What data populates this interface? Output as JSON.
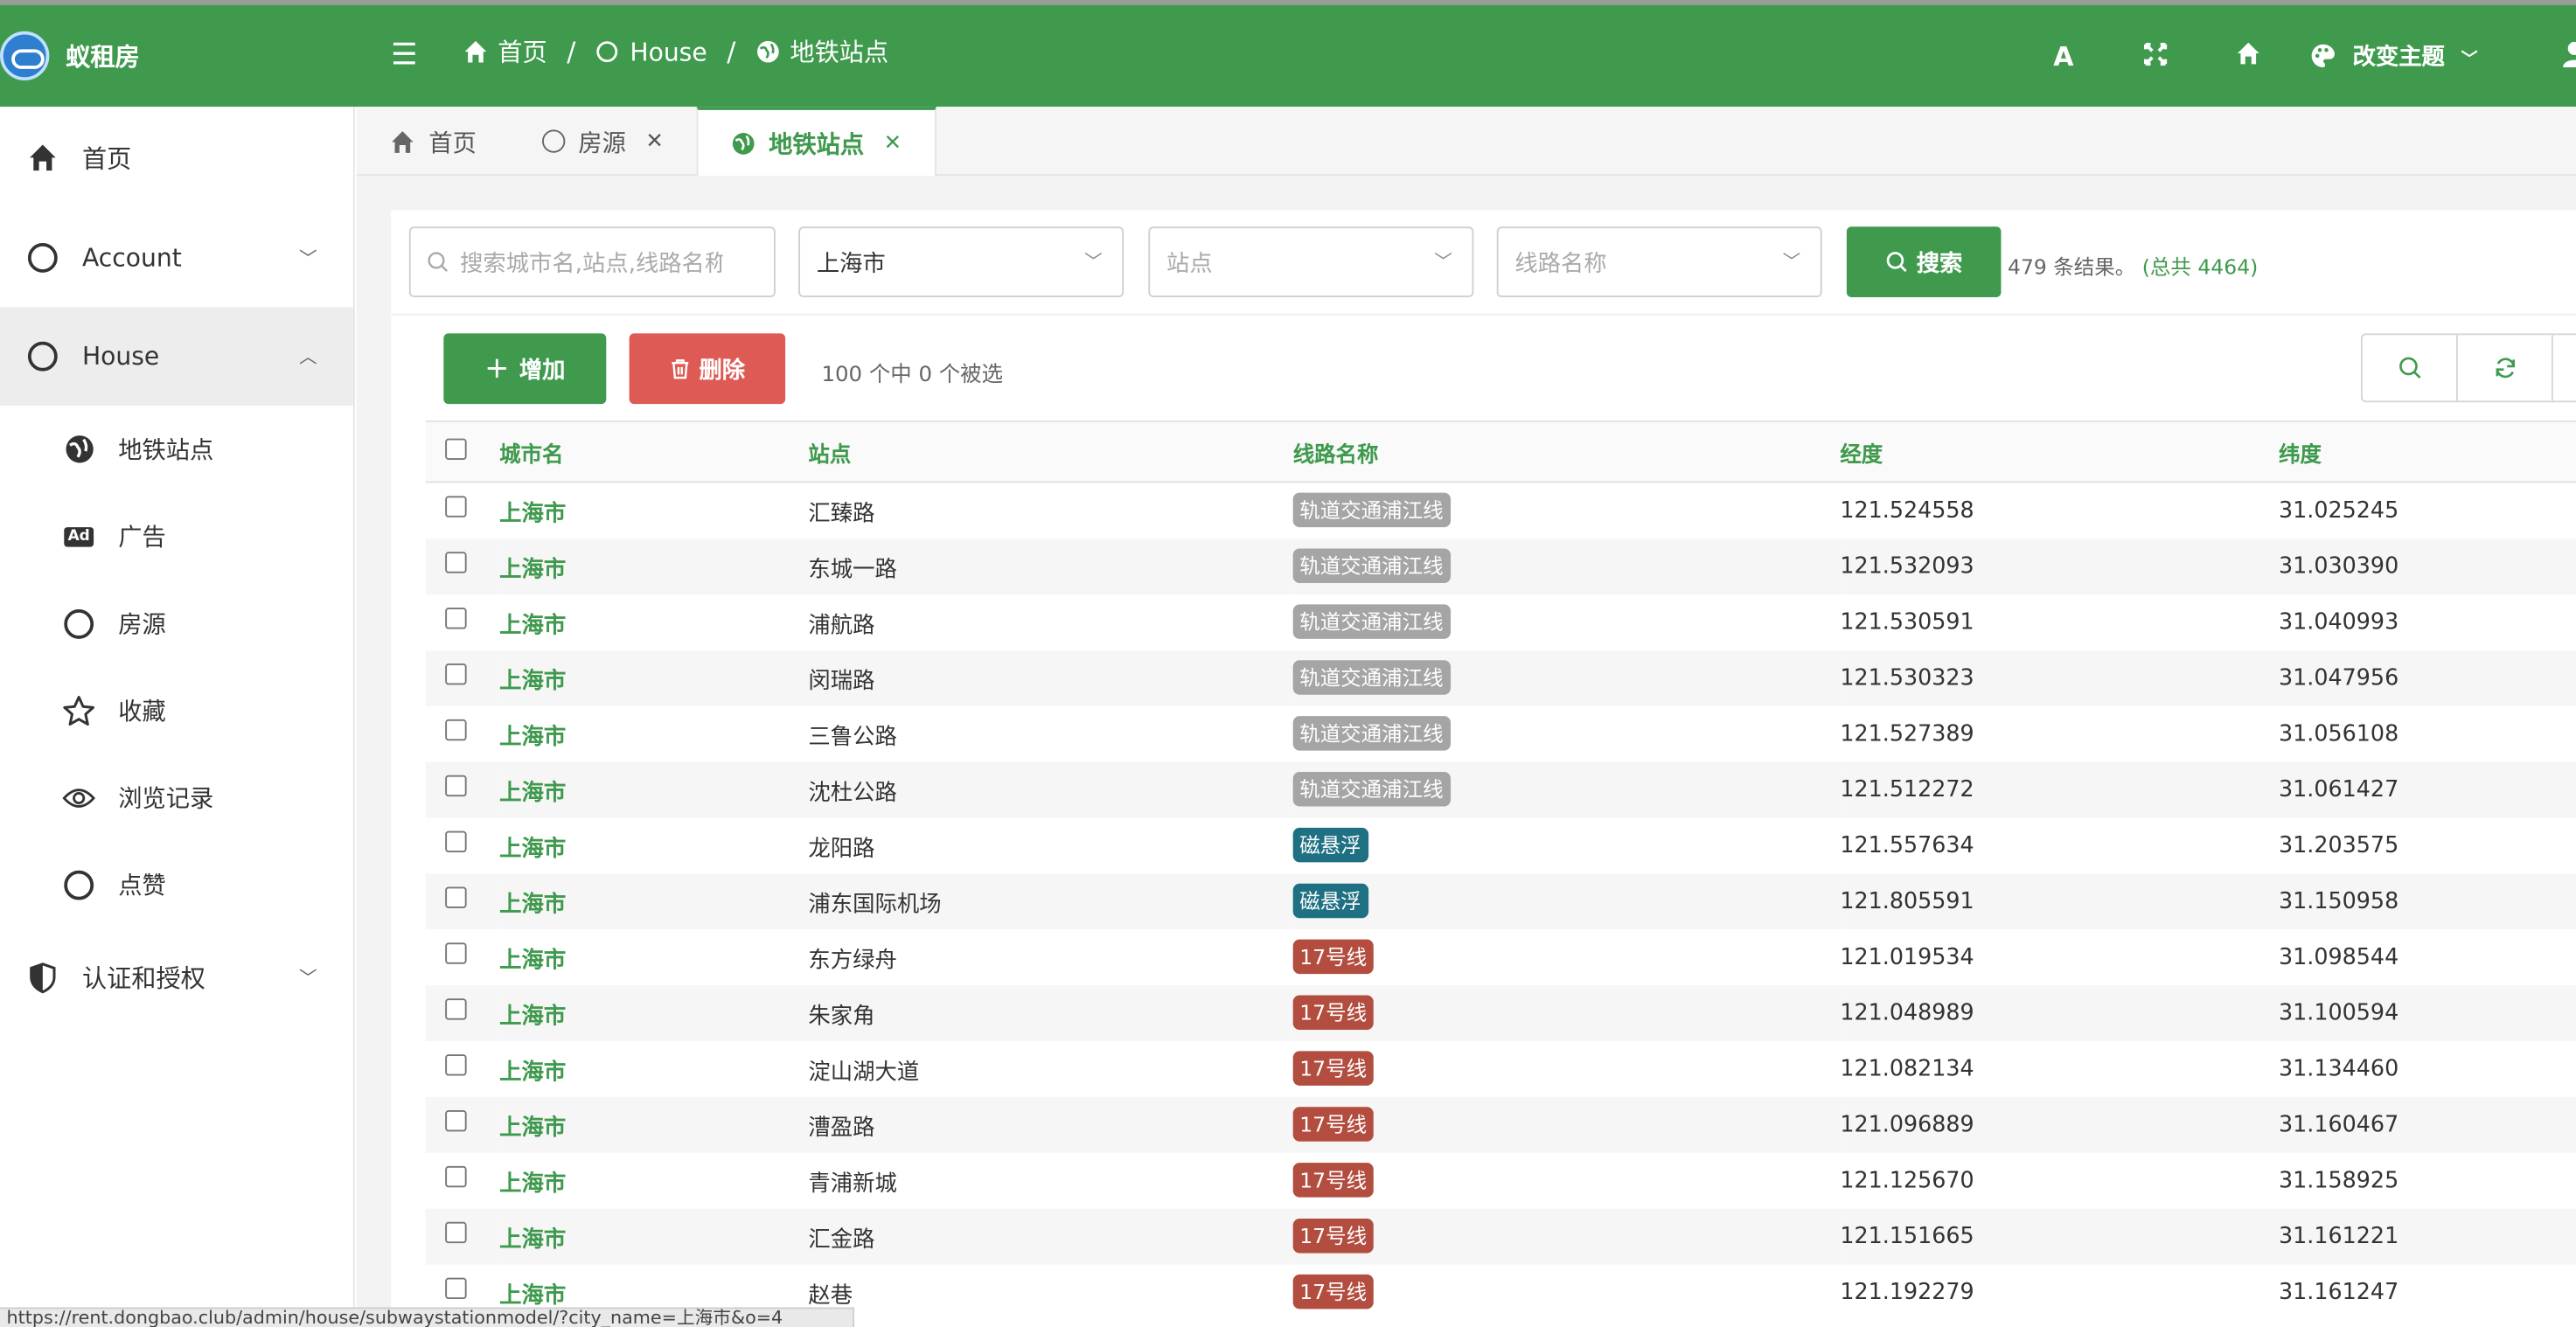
{
  "app": {
    "brand": "蚁租房",
    "colors": {
      "primary": "#3f9a4e",
      "danger": "#de5a55",
      "tag_grey": "#a5a5a5",
      "tag_teal": "#1f7083",
      "tag_red": "#b24d3f"
    }
  },
  "header": {
    "breadcrumb": [
      {
        "label": "首页",
        "icon": "home-icon"
      },
      {
        "label": "House",
        "icon": "circle-icon"
      },
      {
        "label": "地铁站点",
        "icon": "globe-icon"
      }
    ],
    "icons": [
      "font-icon",
      "fullscreen-icon",
      "home-icon"
    ],
    "theme_label": "改变主题"
  },
  "sidebar": {
    "items": [
      {
        "label": "首页",
        "icon": "home-icon"
      },
      {
        "label": "Account",
        "icon": "circle-icon"
      },
      {
        "label": "House",
        "icon": "circle-icon"
      }
    ],
    "sub_items": [
      {
        "label": "地铁站点",
        "icon": "globe-icon"
      },
      {
        "label": "广告",
        "icon": "ad-icon"
      },
      {
        "label": "房源",
        "icon": "circle-icon"
      },
      {
        "label": "收藏",
        "icon": "star-icon"
      },
      {
        "label": "浏览记录",
        "icon": "eye-icon"
      },
      {
        "label": "点赞",
        "icon": "circle-icon"
      }
    ],
    "auth_item": {
      "label": "认证和授权",
      "icon": "shield-icon"
    }
  },
  "tabs": [
    {
      "label": "首页",
      "icon": "home-icon"
    },
    {
      "label": "房源",
      "icon": "circle-icon"
    },
    {
      "label": "地铁站点",
      "icon": "globe-icon"
    }
  ],
  "filters": {
    "search_placeholder": "搜索城市名,站点,线路名称",
    "city_value": "上海市",
    "station_placeholder": "站点",
    "line_placeholder": "线路名称",
    "search_button": "搜索",
    "result_text": "479 条结果。",
    "total_text": "(总共 4464)"
  },
  "actions": {
    "add_label": "增加",
    "delete_label": "删除",
    "selected_text": "100 个中 0 个被选"
  },
  "table": {
    "headers": [
      "城市名",
      "站点",
      "线路名称",
      "经度",
      "纬度"
    ],
    "rows": [
      {
        "city": "上海市",
        "station": "汇臻路",
        "line": "轨道交通浦江线",
        "line_color": "#a5a5a5",
        "lng": "121.524558",
        "lat": "31.025245"
      },
      {
        "city": "上海市",
        "station": "东城一路",
        "line": "轨道交通浦江线",
        "line_color": "#a5a5a5",
        "lng": "121.532093",
        "lat": "31.030390"
      },
      {
        "city": "上海市",
        "station": "浦航路",
        "line": "轨道交通浦江线",
        "line_color": "#a5a5a5",
        "lng": "121.530591",
        "lat": "31.040993"
      },
      {
        "city": "上海市",
        "station": "闵瑞路",
        "line": "轨道交通浦江线",
        "line_color": "#a5a5a5",
        "lng": "121.530323",
        "lat": "31.047956"
      },
      {
        "city": "上海市",
        "station": "三鲁公路",
        "line": "轨道交通浦江线",
        "line_color": "#a5a5a5",
        "lng": "121.527389",
        "lat": "31.056108"
      },
      {
        "city": "上海市",
        "station": "沈杜公路",
        "line": "轨道交通浦江线",
        "line_color": "#a5a5a5",
        "lng": "121.512272",
        "lat": "31.061427"
      },
      {
        "city": "上海市",
        "station": "龙阳路",
        "line": "磁悬浮",
        "line_color": "#1f7083",
        "lng": "121.557634",
        "lat": "31.203575"
      },
      {
        "city": "上海市",
        "station": "浦东国际机场",
        "line": "磁悬浮",
        "line_color": "#1f7083",
        "lng": "121.805591",
        "lat": "31.150958"
      },
      {
        "city": "上海市",
        "station": "东方绿舟",
        "line": "17号线",
        "line_color": "#b24d3f",
        "lng": "121.019534",
        "lat": "31.098544"
      },
      {
        "city": "上海市",
        "station": "朱家角",
        "line": "17号线",
        "line_color": "#b24d3f",
        "lng": "121.048989",
        "lat": "31.100594"
      },
      {
        "city": "上海市",
        "station": "淀山湖大道",
        "line": "17号线",
        "line_color": "#b24d3f",
        "lng": "121.082134",
        "lat": "31.134460"
      },
      {
        "city": "上海市",
        "station": "漕盈路",
        "line": "17号线",
        "line_color": "#b24d3f",
        "lng": "121.096889",
        "lat": "31.160467"
      },
      {
        "city": "上海市",
        "station": "青浦新城",
        "line": "17号线",
        "line_color": "#b24d3f",
        "lng": "121.125670",
        "lat": "31.158925"
      },
      {
        "city": "上海市",
        "station": "汇金路",
        "line": "17号线",
        "line_color": "#b24d3f",
        "lng": "121.151665",
        "lat": "31.161221"
      },
      {
        "city": "上海市",
        "station": "赵巷",
        "line": "17号线",
        "line_color": "#b24d3f",
        "lng": "121.192279",
        "lat": "31.161247"
      }
    ]
  },
  "status_url": "https://rent.dongbao.club/admin/house/subwaystationmodel/?city_name=上海市&o=4"
}
